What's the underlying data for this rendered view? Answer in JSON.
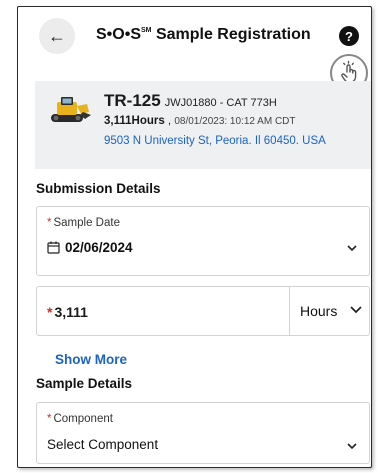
{
  "header": {
    "title_main": "S•O•S",
    "title_mark": "SM",
    "title_rest": " Sample Registration",
    "help_label": "?"
  },
  "asset": {
    "id": "TR-125",
    "serial_model": "JWJ01880 - CAT 773H",
    "hours": "3,111Hours",
    "reading_datetime": "08/01/2023: 10:12 AM CDT",
    "address": "9503 N University St, Peoria. Il 60450. USA"
  },
  "submission": {
    "section_title": "Submission Details",
    "sample_date_label": "Sample Date",
    "sample_date_value": "02/06/2024",
    "hours_value": "3,111",
    "hours_unit": "Hours",
    "show_more_label": "Show More"
  },
  "sample": {
    "section_title": "Sample Details",
    "component_label": "Component",
    "component_value": "Select Component"
  },
  "required_marker": "*",
  "colors": {
    "accent": "#1d62c4",
    "required": "#d62a2a",
    "card_bg": "#eef0f2",
    "machine_yellow": "#e8b21c"
  }
}
